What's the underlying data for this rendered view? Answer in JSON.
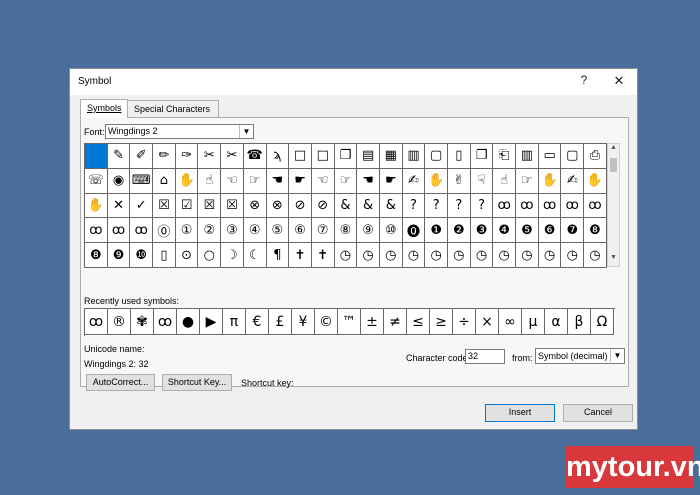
{
  "window": {
    "title": "Symbol",
    "help": "?",
    "close": "✕"
  },
  "tabs": [
    {
      "label": "Symbols",
      "active": true
    },
    {
      "label": "Special Characters",
      "active": false
    }
  ],
  "font": {
    "label": "Font:",
    "value": "Wingdings 2"
  },
  "symbol_grid": {
    "selected_index": 0,
    "rows": [
      [
        "",
        "✎",
        "✐",
        "✏",
        "✑",
        "✂",
        "✂",
        "☎",
        "ϡ",
        "□",
        "□",
        "❐",
        "▤",
        "▦",
        "▥",
        "▢",
        "▯",
        "❐",
        "⎗",
        "▥",
        "▭",
        "▢",
        "⎙"
      ],
      [
        "☏",
        "◉",
        "⌨",
        "⌂",
        "✋",
        "☝",
        "☜",
        "☞",
        "☚",
        "☛",
        "☜",
        "☞",
        "☚",
        "☛",
        "✍",
        "✋",
        "✌",
        "☟",
        "☝",
        "☞",
        "✋",
        "✍",
        "✋"
      ],
      [
        "✋",
        "✕",
        "✓",
        "☒",
        "☑",
        "☒",
        "☒",
        "⊗",
        "⊗",
        "⊘",
        "⊘",
        "&",
        "&",
        "&",
        "?",
        "?",
        "?",
        "?",
        "ꝏ",
        "ꝏ",
        "ꝏ",
        "ꝏ",
        "ꝏ"
      ],
      [
        "ꝏ",
        "ꝏ",
        "ꝏ",
        "⓪",
        "①",
        "②",
        "③",
        "④",
        "⑤",
        "⑥",
        "⑦",
        "⑧",
        "⑨",
        "⑩",
        "⓿",
        "❶",
        "❷",
        "❸",
        "❹",
        "❺",
        "❻",
        "❼",
        "❽"
      ],
      [
        "❽",
        "❾",
        "❿",
        "▯",
        "⊙",
        "○",
        "☽",
        "☾",
        "¶",
        "✝",
        "✝",
        "◷",
        "◷",
        "◷",
        "◷",
        "◷",
        "◷",
        "◷",
        "◷",
        "◷",
        "◷",
        "◷",
        "◷"
      ]
    ]
  },
  "recent": {
    "label": "Recently used symbols:",
    "symbols": [
      "ꝏ",
      "®",
      "✾",
      "ꝏ",
      "●",
      "▶",
      "π",
      "€",
      "£",
      "¥",
      "©",
      "™",
      "±",
      "≠",
      "≤",
      "≥",
      "÷",
      "×",
      "∞",
      "µ",
      "α",
      "β",
      "Ω"
    ]
  },
  "unicode": {
    "label": "Unicode name:",
    "value": "Wingdings 2: 32"
  },
  "character_code": {
    "label": "Character code:",
    "value": "32"
  },
  "from": {
    "label": "from:",
    "value": "Symbol (decimal)"
  },
  "buttons": {
    "autocorrect": "AutoCorrect...",
    "shortcut_key": "Shortcut Key...",
    "insert": "Insert",
    "cancel": "Cancel"
  },
  "shortcut_key_label": "Shortcut key:",
  "watermark": "mytour.vn",
  "colors": {
    "background": "#4a6e9c",
    "selected": "#0078d7",
    "watermark": "#d8383b"
  }
}
